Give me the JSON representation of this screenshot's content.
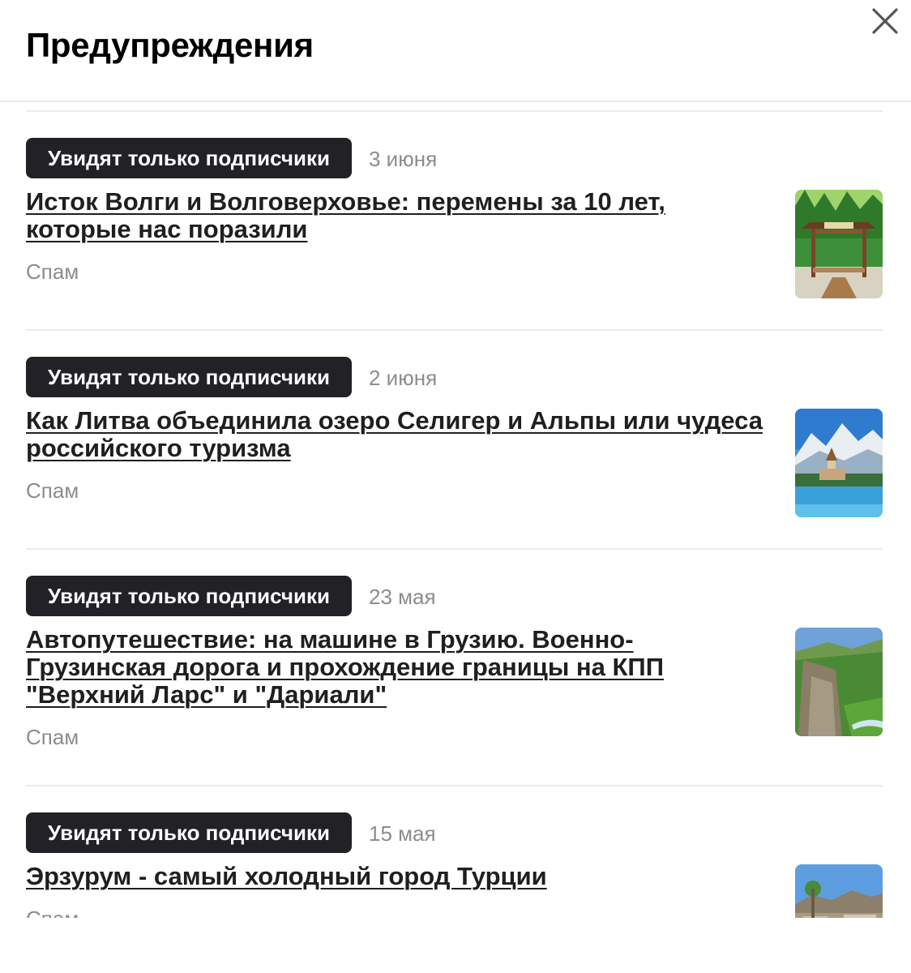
{
  "dialog": {
    "title": "Предупреждения",
    "close_icon": "close-icon"
  },
  "warnings": [
    {
      "badge": "Увидят только подписчики",
      "date": "3 июня",
      "headline": "Исток Волги и Волговерховье: перемены за 10 лет, которые нас поразили",
      "reason": "Спам",
      "thumbnail": "wooden-chapel-forest-photo"
    },
    {
      "badge": "Увидят только подписчики",
      "date": "2 июня",
      "headline": "Как Литва объединила озеро Селигер и Альпы или чудеса российского туризма",
      "reason": "Спам",
      "thumbnail": "lake-island-church-mountains-photo"
    },
    {
      "badge": "Увидят только подписчики",
      "date": "23 мая",
      "headline": "Автопутешествие: на машине в Грузию. Военно-Грузинская дорога и прохождение границы на КПП \"Верхний Ларс\" и \"Дариали\"",
      "reason": "Спам",
      "thumbnail": "mountain-gorge-photo"
    },
    {
      "badge": "Увидят только подписчики",
      "date": "15 мая",
      "headline": "Эрзурум - самый холодный город Турции",
      "reason": "Спам",
      "thumbnail": "city-mountains-photo"
    }
  ]
}
